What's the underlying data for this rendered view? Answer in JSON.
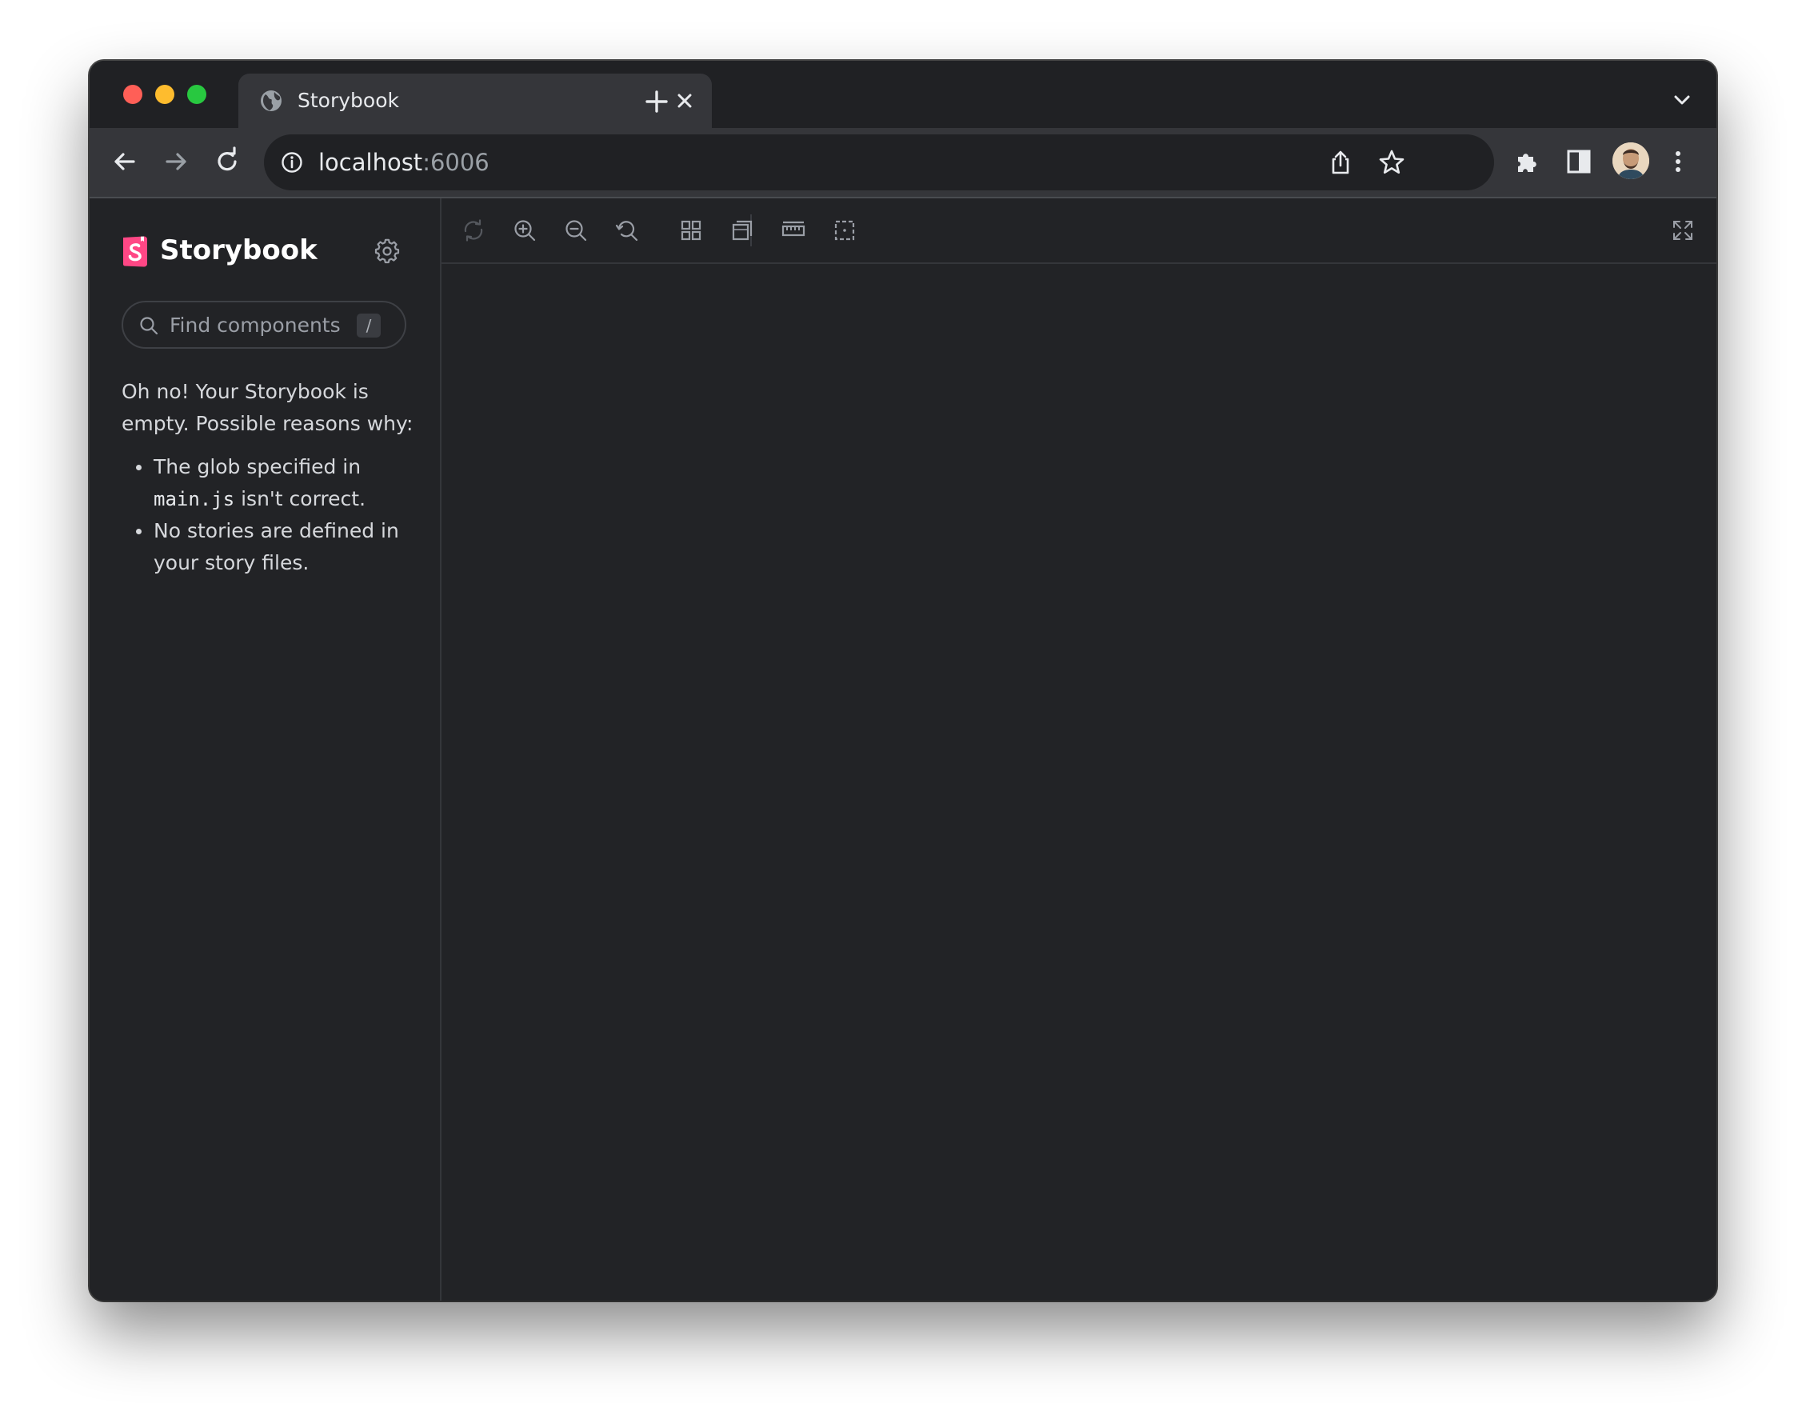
{
  "browser": {
    "tab": {
      "title": "Storybook"
    },
    "address_bar": {
      "host": "localhost",
      "port": ":6006"
    }
  },
  "sidebar": {
    "brand": "Storybook",
    "search": {
      "placeholder": "Find components",
      "shortcut": "/"
    },
    "empty_state": {
      "message": "Oh no! Your Storybook is empty. Possible reasons why:",
      "reasons": [
        {
          "before": "The glob specified in ",
          "code": "main.js",
          "after": " isn't correct."
        },
        {
          "before": "No stories are defined in your story files.",
          "code": "",
          "after": ""
        }
      ]
    }
  },
  "colors": {
    "brand_pink": "#ff4785",
    "background": "#222326",
    "chrome_toolbar": "#35363a",
    "chrome_tabstrip": "#202124"
  },
  "icons": {
    "tab_favicon": "globe-icon",
    "tab_close": "close-icon",
    "new_tab": "plus-icon",
    "tab_search": "chevron-down-icon",
    "back": "arrow-left-icon",
    "forward": "arrow-right-icon",
    "reload": "reload-icon",
    "site_info": "info-icon",
    "share": "share-icon",
    "bookmark": "star-icon",
    "extensions": "puzzle-icon",
    "side_panel": "side-panel-icon",
    "profile": "avatar",
    "menu": "kebab-menu-icon",
    "canvas_tools": [
      "sync-icon",
      "zoom-in-icon",
      "zoom-out-icon",
      "zoom-reset-icon",
      "grid-icon",
      "background-icon",
      "ruler-icon",
      "outline-icon",
      "fullscreen-icon"
    ]
  }
}
